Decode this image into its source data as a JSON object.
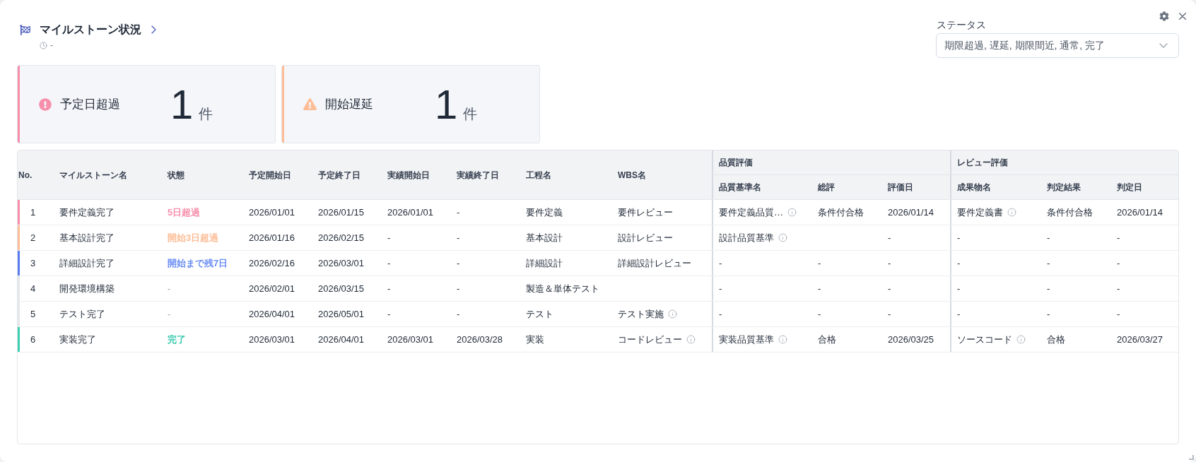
{
  "header": {
    "title": "マイルストーン状況",
    "updated": "-"
  },
  "filter": {
    "label": "ステータス",
    "value": "期限超過, 遅延, 期限間近, 通常, 完了"
  },
  "cards": [
    {
      "kind": "overdue",
      "label": "予定日超過",
      "count": "1",
      "unit": "件",
      "color": "#f78fab"
    },
    {
      "kind": "delayed",
      "label": "開始遅延",
      "count": "1",
      "unit": "件",
      "color": "#fdbd96"
    }
  ],
  "table": {
    "columns": [
      "No.",
      "マイルストーン名",
      "状態",
      "予定開始日",
      "予定終了日",
      "実績開始日",
      "実績終了日",
      "工程名",
      "WBS名"
    ],
    "groups": [
      {
        "label": "品質評価",
        "columns": [
          "品質基準名",
          "総評",
          "評価日"
        ]
      },
      {
        "label": "レビュー評価",
        "columns": [
          "成果物名",
          "判定結果",
          "判定日"
        ]
      }
    ],
    "rows": [
      {
        "color": "#f78fab",
        "no": "1",
        "name": "要件定義完了",
        "status": {
          "text": "5日超過",
          "color": "#f78fab"
        },
        "planned_start": "2026/01/01",
        "planned_end": "2026/01/15",
        "actual_start": "2026/01/01",
        "actual_end": "-",
        "process": "要件定義",
        "wbs": {
          "text": "要件レビュー",
          "info": false
        },
        "quality": {
          "standard": {
            "text": "要件定義品質…",
            "info": true
          },
          "rating": "条件付合格",
          "date": "2026/01/14"
        },
        "review": {
          "deliverable": {
            "text": "要件定義書",
            "info": true
          },
          "result": "条件付合格",
          "date": "2026/01/14"
        }
      },
      {
        "color": "#fdbd96",
        "no": "2",
        "name": "基本設計完了",
        "status": {
          "text": "開始3日超過",
          "color": "#fdbd96"
        },
        "planned_start": "2026/01/16",
        "planned_end": "2026/02/15",
        "actual_start": "-",
        "actual_end": "-",
        "process": "基本設計",
        "wbs": {
          "text": "設計レビュー",
          "info": false
        },
        "quality": {
          "standard": {
            "text": "設計品質基準",
            "info": true
          },
          "date": "-"
        },
        "review": {
          "deliverable": {
            "text": "-",
            "info": false
          },
          "result": "-",
          "date": "-"
        }
      },
      {
        "color": "#5b7cf0",
        "no": "3",
        "name": "詳細設計完了",
        "status": {
          "text": "開始まで残7日",
          "color": "#6b8ef5"
        },
        "planned_start": "2026/02/16",
        "planned_end": "2026/03/01",
        "actual_start": "-",
        "actual_end": "-",
        "process": "詳細設計",
        "wbs": {
          "text": "詳細設計レビュー",
          "info": false
        },
        "quality": {
          "standard": {
            "text": "-",
            "info": false
          },
          "rating": "-",
          "date": "-"
        },
        "review": {
          "deliverable": {
            "text": "-",
            "info": false
          },
          "result": "-",
          "date": "-"
        }
      },
      {
        "color": "#e5e7eb",
        "no": "4",
        "name": "開発環境構築",
        "status": {
          "text": "-"
        },
        "planned_start": "2026/02/01",
        "planned_end": "2026/03/15",
        "actual_start": "-",
        "actual_end": "-",
        "process": "製造＆単体テスト",
        "quality": {
          "standard": {
            "text": "-",
            "info": false
          },
          "rating": "-",
          "date": "-"
        },
        "review": {
          "deliverable": {
            "text": "-",
            "info": false
          },
          "result": "-",
          "date": "-"
        }
      },
      {
        "color": "#e5e7eb",
        "no": "5",
        "name": "テスト完了",
        "status": {
          "text": "-"
        },
        "planned_start": "2026/04/01",
        "planned_end": "2026/05/01",
        "actual_start": "-",
        "actual_end": "-",
        "process": "テスト",
        "wbs": {
          "text": "テスト実施",
          "info": true
        },
        "quality": {
          "standard": {
            "text": "-",
            "info": false
          },
          "rating": "-",
          "date": "-"
        },
        "review": {
          "deliverable": {
            "text": "-",
            "info": false
          },
          "result": "-",
          "date": "-"
        }
      },
      {
        "color": "#3ccfb2",
        "no": "6",
        "name": "実装完了",
        "status": {
          "text": "完了",
          "color": "#36c9ad"
        },
        "planned_start": "2026/03/01",
        "planned_end": "2026/04/01",
        "actual_start": "2026/03/01",
        "actual_end": "2026/03/28",
        "process": "実装",
        "wbs": {
          "text": "コードレビュー",
          "info": true
        },
        "quality": {
          "standard": {
            "text": "実装品質基準",
            "info": true
          },
          "rating": "合格",
          "date": "2026/03/25"
        },
        "review": {
          "deliverable": {
            "text": "ソースコード",
            "info": true
          },
          "result": "合格",
          "date": "2026/03/27"
        }
      }
    ]
  }
}
